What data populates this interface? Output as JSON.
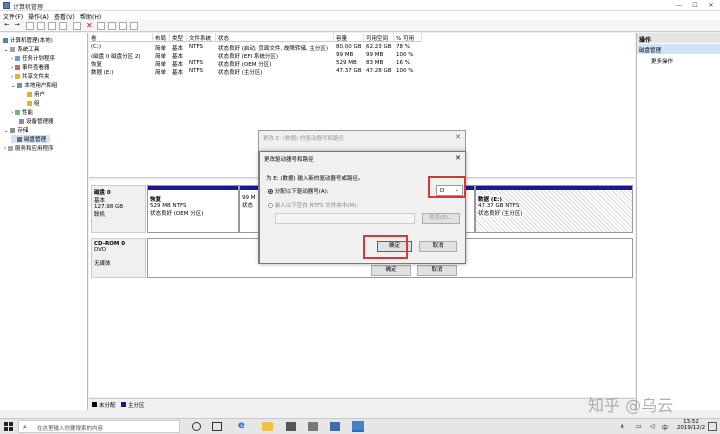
{
  "window": {
    "title": "计算机管理",
    "minimize": "—",
    "maximize": "☐",
    "close": "✕"
  },
  "menu": [
    "文件(F)",
    "操作(A)",
    "查看(V)",
    "帮助(H)"
  ],
  "tree": [
    {
      "label": "计算机管理(本地)",
      "depth": 0
    },
    {
      "label": "系统工具",
      "depth": 1
    },
    {
      "label": "任务计划程序",
      "depth": 2
    },
    {
      "label": "事件查看器",
      "depth": 2
    },
    {
      "label": "共享文件夹",
      "depth": 2
    },
    {
      "label": "本地用户和组",
      "depth": 2
    },
    {
      "label": "用户",
      "depth": 3
    },
    {
      "label": "组",
      "depth": 3
    },
    {
      "label": "性能",
      "depth": 2
    },
    {
      "label": "设备管理器",
      "depth": 2
    },
    {
      "label": "存储",
      "depth": 1
    },
    {
      "label": "磁盘管理",
      "depth": 2
    },
    {
      "label": "服务和应用程序",
      "depth": 1
    }
  ],
  "volumes": {
    "headers": [
      "卷",
      "布局",
      "类型",
      "文件系统",
      "状态",
      "容量",
      "可用空间",
      "% 可用"
    ],
    "rows": [
      [
        "(C:)",
        "简单",
        "基本",
        "NTFS",
        "状态良好 (启动, 页面文件, 故障转储, 主分区)",
        "80.00 GB",
        "62.23 GB",
        "78 %"
      ],
      [
        "(磁盘 0 磁盘分区 2)",
        "简单",
        "基本",
        "",
        "状态良好 (EFI 系统分区)",
        "99 MB",
        "99 MB",
        "100 %"
      ],
      [
        "恢复",
        "简单",
        "基本",
        "NTFS",
        "状态良好 (OEM 分区)",
        "529 MB",
        "83 MB",
        "16 %"
      ],
      [
        "数据 (E:)",
        "简单",
        "基本",
        "NTFS",
        "状态良好 (主分区)",
        "47.37 GB",
        "47.28 GB",
        "100 %"
      ]
    ]
  },
  "disks": {
    "disk0": {
      "name": "磁盘 0",
      "type": "基本",
      "size": "127.98 GB",
      "status": "联机",
      "partitions": [
        {
          "name": "恢复",
          "size": "529 MB NTFS",
          "status": "状态良好 (OEM 分区)"
        },
        {
          "name": "",
          "size": "99 M",
          "status": "状态"
        },
        {
          "name": "数据 (E:)",
          "size": "47.37 GB NTFS",
          "status": "状态良好 (主分区)"
        }
      ]
    },
    "cdrom": {
      "name": "CD-ROM 0",
      "type": "DVD",
      "status": "无媒体"
    }
  },
  "legend": {
    "unallocated": "未分配",
    "primary": "主分区"
  },
  "actions": {
    "header": "操作",
    "selected": "磁盘管理",
    "more": "更多操作"
  },
  "dialog_back": {
    "title": "更改 E: (数据) 的驱动器号和路径",
    "ok": "确定",
    "cancel": "取消"
  },
  "dialog_front": {
    "title": "更改驱动器号和路径",
    "prompt": "为 E: (数据) 输入新的驱动器号或路径。",
    "option_letter": "分配以下驱动器号(A):",
    "option_folder": "装入以下空白 NTFS 文件夹中(M):",
    "letter_value": "D",
    "browse": "浏览(B)...",
    "ok": "确定",
    "cancel": "取消"
  },
  "taskbar": {
    "search_placeholder": "在这里输入你要搜索的内容",
    "time": "13:52",
    "date": "2019/12/2"
  },
  "watermark": "知乎 @乌云",
  "colors": {
    "primary_partition": "#1a1a8c",
    "highlight_red": "#d03a3a",
    "selection": "#cfe3f7"
  }
}
